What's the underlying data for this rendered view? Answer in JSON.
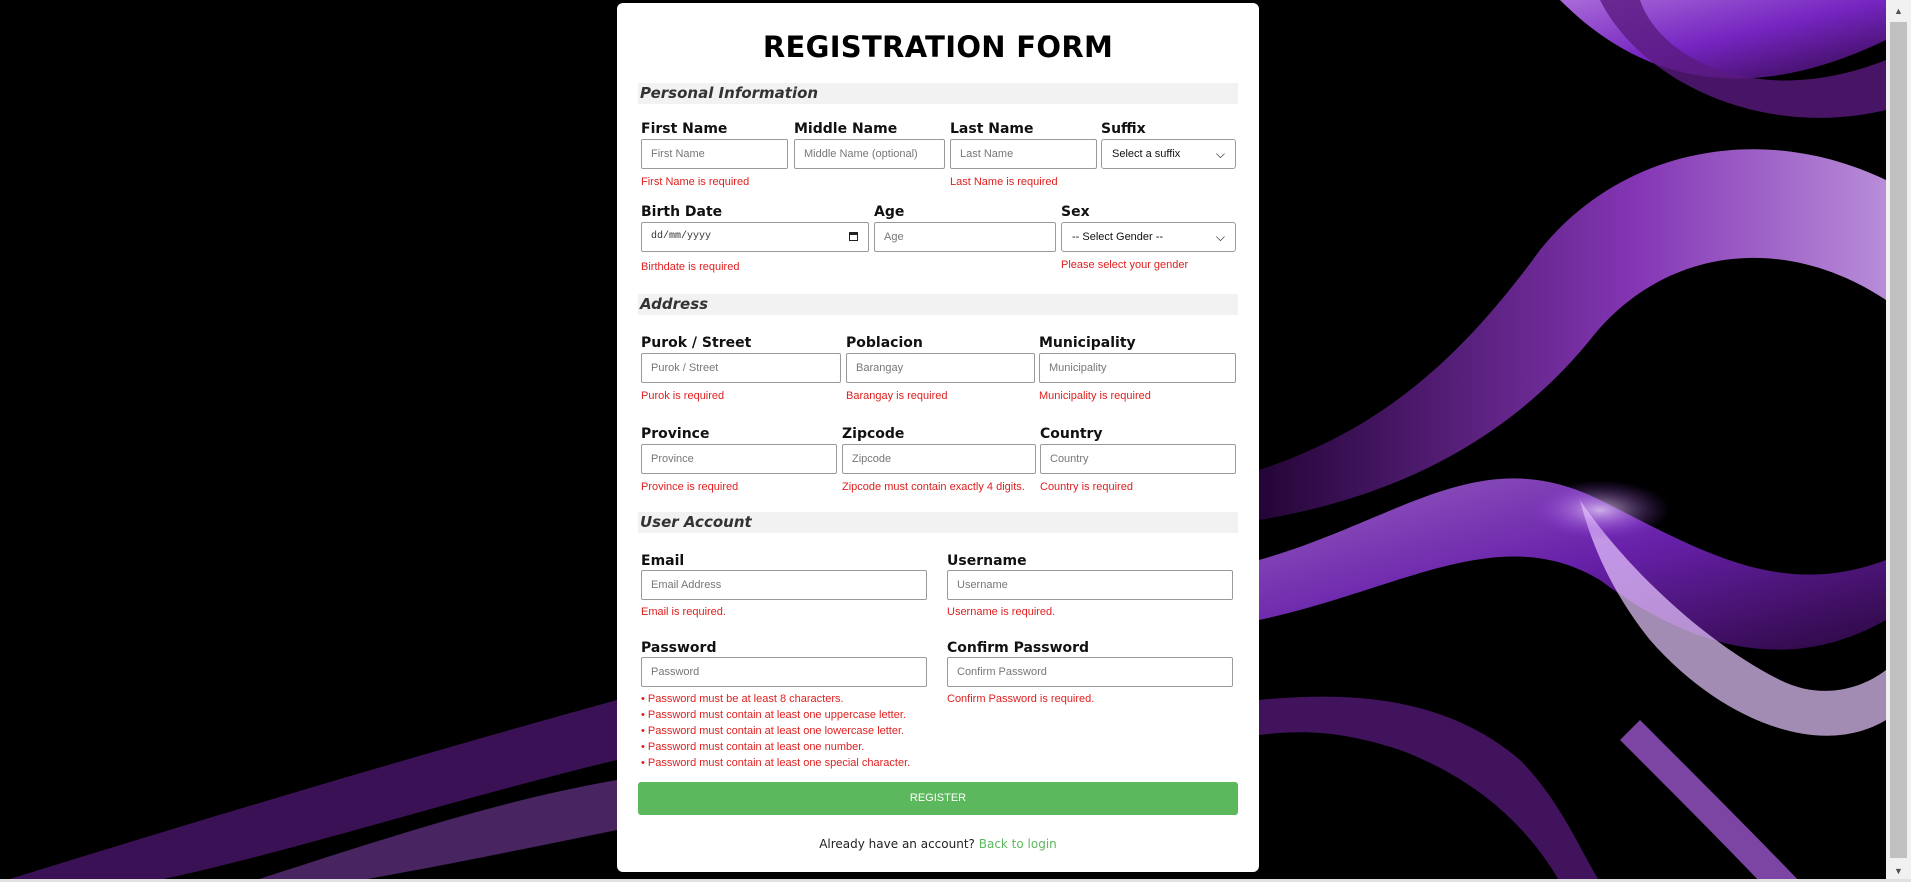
{
  "form": {
    "title": "REGISTRATION FORM",
    "sections": {
      "personal": "Personal Information",
      "address": "Address",
      "account": "User Account"
    },
    "personal": {
      "first_name": {
        "label": "First Name",
        "placeholder": "First Name",
        "error": "First Name is required"
      },
      "middle_name": {
        "label": "Middle Name",
        "placeholder": "Middle Name (optional)"
      },
      "last_name": {
        "label": "Last Name",
        "placeholder": "Last Name",
        "error": "Last Name is required"
      },
      "suffix": {
        "label": "Suffix",
        "selected": "Select a suffix"
      },
      "birth_date": {
        "label": "Birth Date",
        "placeholder": "dd/mm/yyyy",
        "error": "Birthdate is required"
      },
      "age": {
        "label": "Age",
        "placeholder": "Age"
      },
      "sex": {
        "label": "Sex",
        "selected": "-- Select Gender --",
        "error": "Please select your gender"
      }
    },
    "address": {
      "street": {
        "label": "Purok / Street",
        "placeholder": "Purok / Street",
        "error": "Purok is required"
      },
      "poblacion": {
        "label": "Poblacion",
        "placeholder": "Barangay",
        "error": "Barangay is required"
      },
      "municipality": {
        "label": "Municipality",
        "placeholder": "Municipality",
        "error": "Municipality is required"
      },
      "province": {
        "label": "Province",
        "placeholder": "Province",
        "error": "Province is required"
      },
      "zipcode": {
        "label": "Zipcode",
        "placeholder": "Zipcode",
        "error": "Zipcode must contain exactly 4 digits."
      },
      "country": {
        "label": "Country",
        "placeholder": "Country",
        "error": "Country is required"
      }
    },
    "account": {
      "email": {
        "label": "Email",
        "placeholder": "Email Address",
        "error": "Email is required."
      },
      "username": {
        "label": "Username",
        "placeholder": "Username",
        "error": "Username is required."
      },
      "password": {
        "label": "Password",
        "placeholder": "Password",
        "errors": [
          "• Password must be at least 8 characters.",
          "• Password must contain at least one uppercase letter.",
          "• Password must contain at least one lowercase letter.",
          "• Password must contain at least one number.",
          "• Password must contain at least one special character."
        ]
      },
      "confirm_password": {
        "label": "Confirm Password",
        "placeholder": "Confirm Password",
        "error": "Confirm Password is required."
      }
    },
    "register_label": "REGISTER",
    "footer_text": "Already have an account?",
    "footer_link": "Back to login"
  },
  "colors": {
    "accent": "#5cb85c",
    "error": "#e02020",
    "background": "#000000",
    "swirl": "#a64dd6"
  },
  "icons": {
    "suffix_dropdown": "chevron-down-icon",
    "sex_dropdown": "chevron-down-icon",
    "birth_date": "calendar-icon"
  }
}
